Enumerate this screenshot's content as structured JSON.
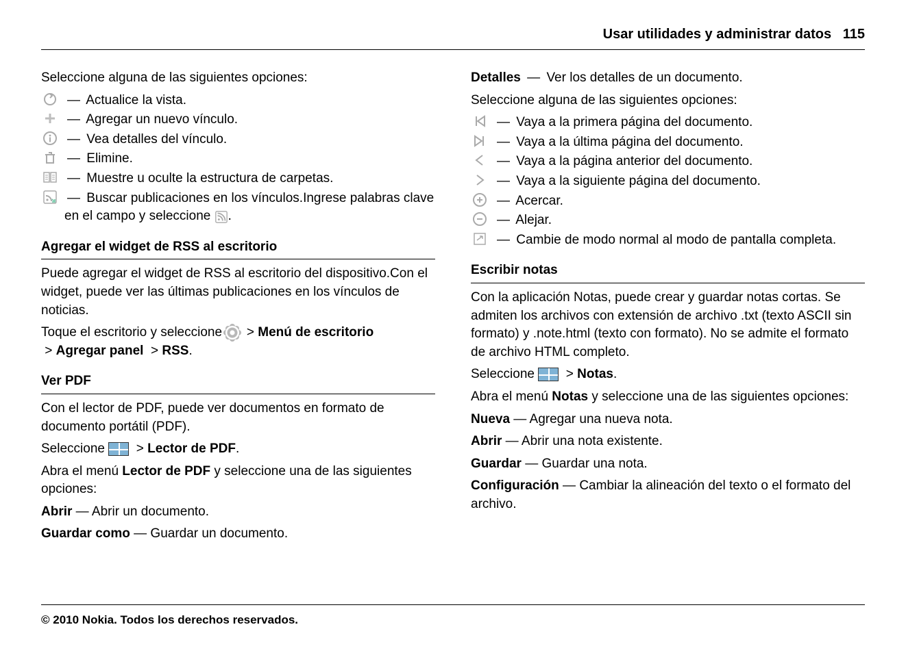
{
  "header": {
    "title": "Usar utilidades y administrar datos",
    "page": "115"
  },
  "left": {
    "intro": "Seleccione alguna de las siguientes opciones:",
    "opts": [
      {
        "icon": "refresh-icon",
        "text": "Actualice la vista."
      },
      {
        "icon": "plus-icon",
        "text": "Agregar un nuevo vínculo."
      },
      {
        "icon": "info-icon",
        "text": "Vea detalles del vínculo."
      },
      {
        "icon": "trash-icon",
        "text": "Elimine."
      },
      {
        "icon": "folders-icon",
        "text": "Muestre u oculte la estructura de carpetas."
      }
    ],
    "searchRow": {
      "pre": "Buscar publicaciones en los vínculos.Ingrese palabras clave en el campo y seleccione",
      "post": "."
    },
    "rssHead": "Agregar el widget de RSS al escritorio",
    "rssBody": "Puede agregar el widget de RSS al escritorio del dispositivo.Con el widget, puede ver las últimas publicaciones en los vínculos de noticias.",
    "rssPath": {
      "pre": "Toque el escritorio y seleccione ",
      "a": "Menú de escritorio",
      "b": "Agregar panel",
      "c": "RSS"
    },
    "pdfHead": "Ver PDF",
    "pdfBody": "Con el lector de PDF, puede ver documentos en formato de documento portátil (PDF).",
    "pdfSelect": {
      "pre": "Seleccione ",
      "target": "Lector de PDF"
    },
    "pdfMenu": {
      "pre": "Abra el menú ",
      "menu": "Lector de PDF",
      "post": " y seleccione una de las siguientes opciones:"
    },
    "pdfItems": [
      {
        "term": "Abrir",
        "desc": "Abrir un documento."
      },
      {
        "term": "Guardar como",
        "desc": "Guardar un documento."
      }
    ]
  },
  "right": {
    "detalles": {
      "term": "Detalles",
      "desc": "Ver los detalles de un documento."
    },
    "intro": "Seleccione alguna de las siguientes opciones:",
    "opts": [
      {
        "icon": "first-page-icon",
        "text": "Vaya a la primera página del documento."
      },
      {
        "icon": "last-page-icon",
        "text": "Vaya a la última página del documento."
      },
      {
        "icon": "prev-page-icon",
        "text": "Vaya a la página anterior del documento."
      },
      {
        "icon": "next-page-icon",
        "text": "Vaya a la siguiente página del documento."
      },
      {
        "icon": "zoom-in-icon",
        "text": "Acercar."
      },
      {
        "icon": "zoom-out-icon",
        "text": "Alejar."
      }
    ],
    "fullscreen": "Cambie de modo normal al modo de pantalla completa.",
    "notesHead": "Escribir notas",
    "notesBody": "Con la aplicación Notas, puede crear y guardar notas cortas. Se admiten los archivos con extensión de archivo .txt (texto ASCII sin formato) y .note.html (texto con formato). No se admite el formato de archivo HTML completo.",
    "notesSelect": {
      "pre": "Seleccione ",
      "target": "Notas"
    },
    "notesMenu": {
      "pre": "Abra el menú ",
      "menu": "Notas",
      "post": " y seleccione una de las siguientes opciones:"
    },
    "notesItems": [
      {
        "term": "Nueva",
        "desc": "Agregar una nueva nota."
      },
      {
        "term": "Abrir",
        "desc": "Abrir una nota existente."
      },
      {
        "term": "Guardar",
        "desc": "Guardar una nota."
      },
      {
        "term": "Configuración",
        "desc": "Cambiar la alineación del texto o el formato del archivo."
      }
    ]
  },
  "footer": "© 2010 Nokia. Todos los derechos reservados."
}
